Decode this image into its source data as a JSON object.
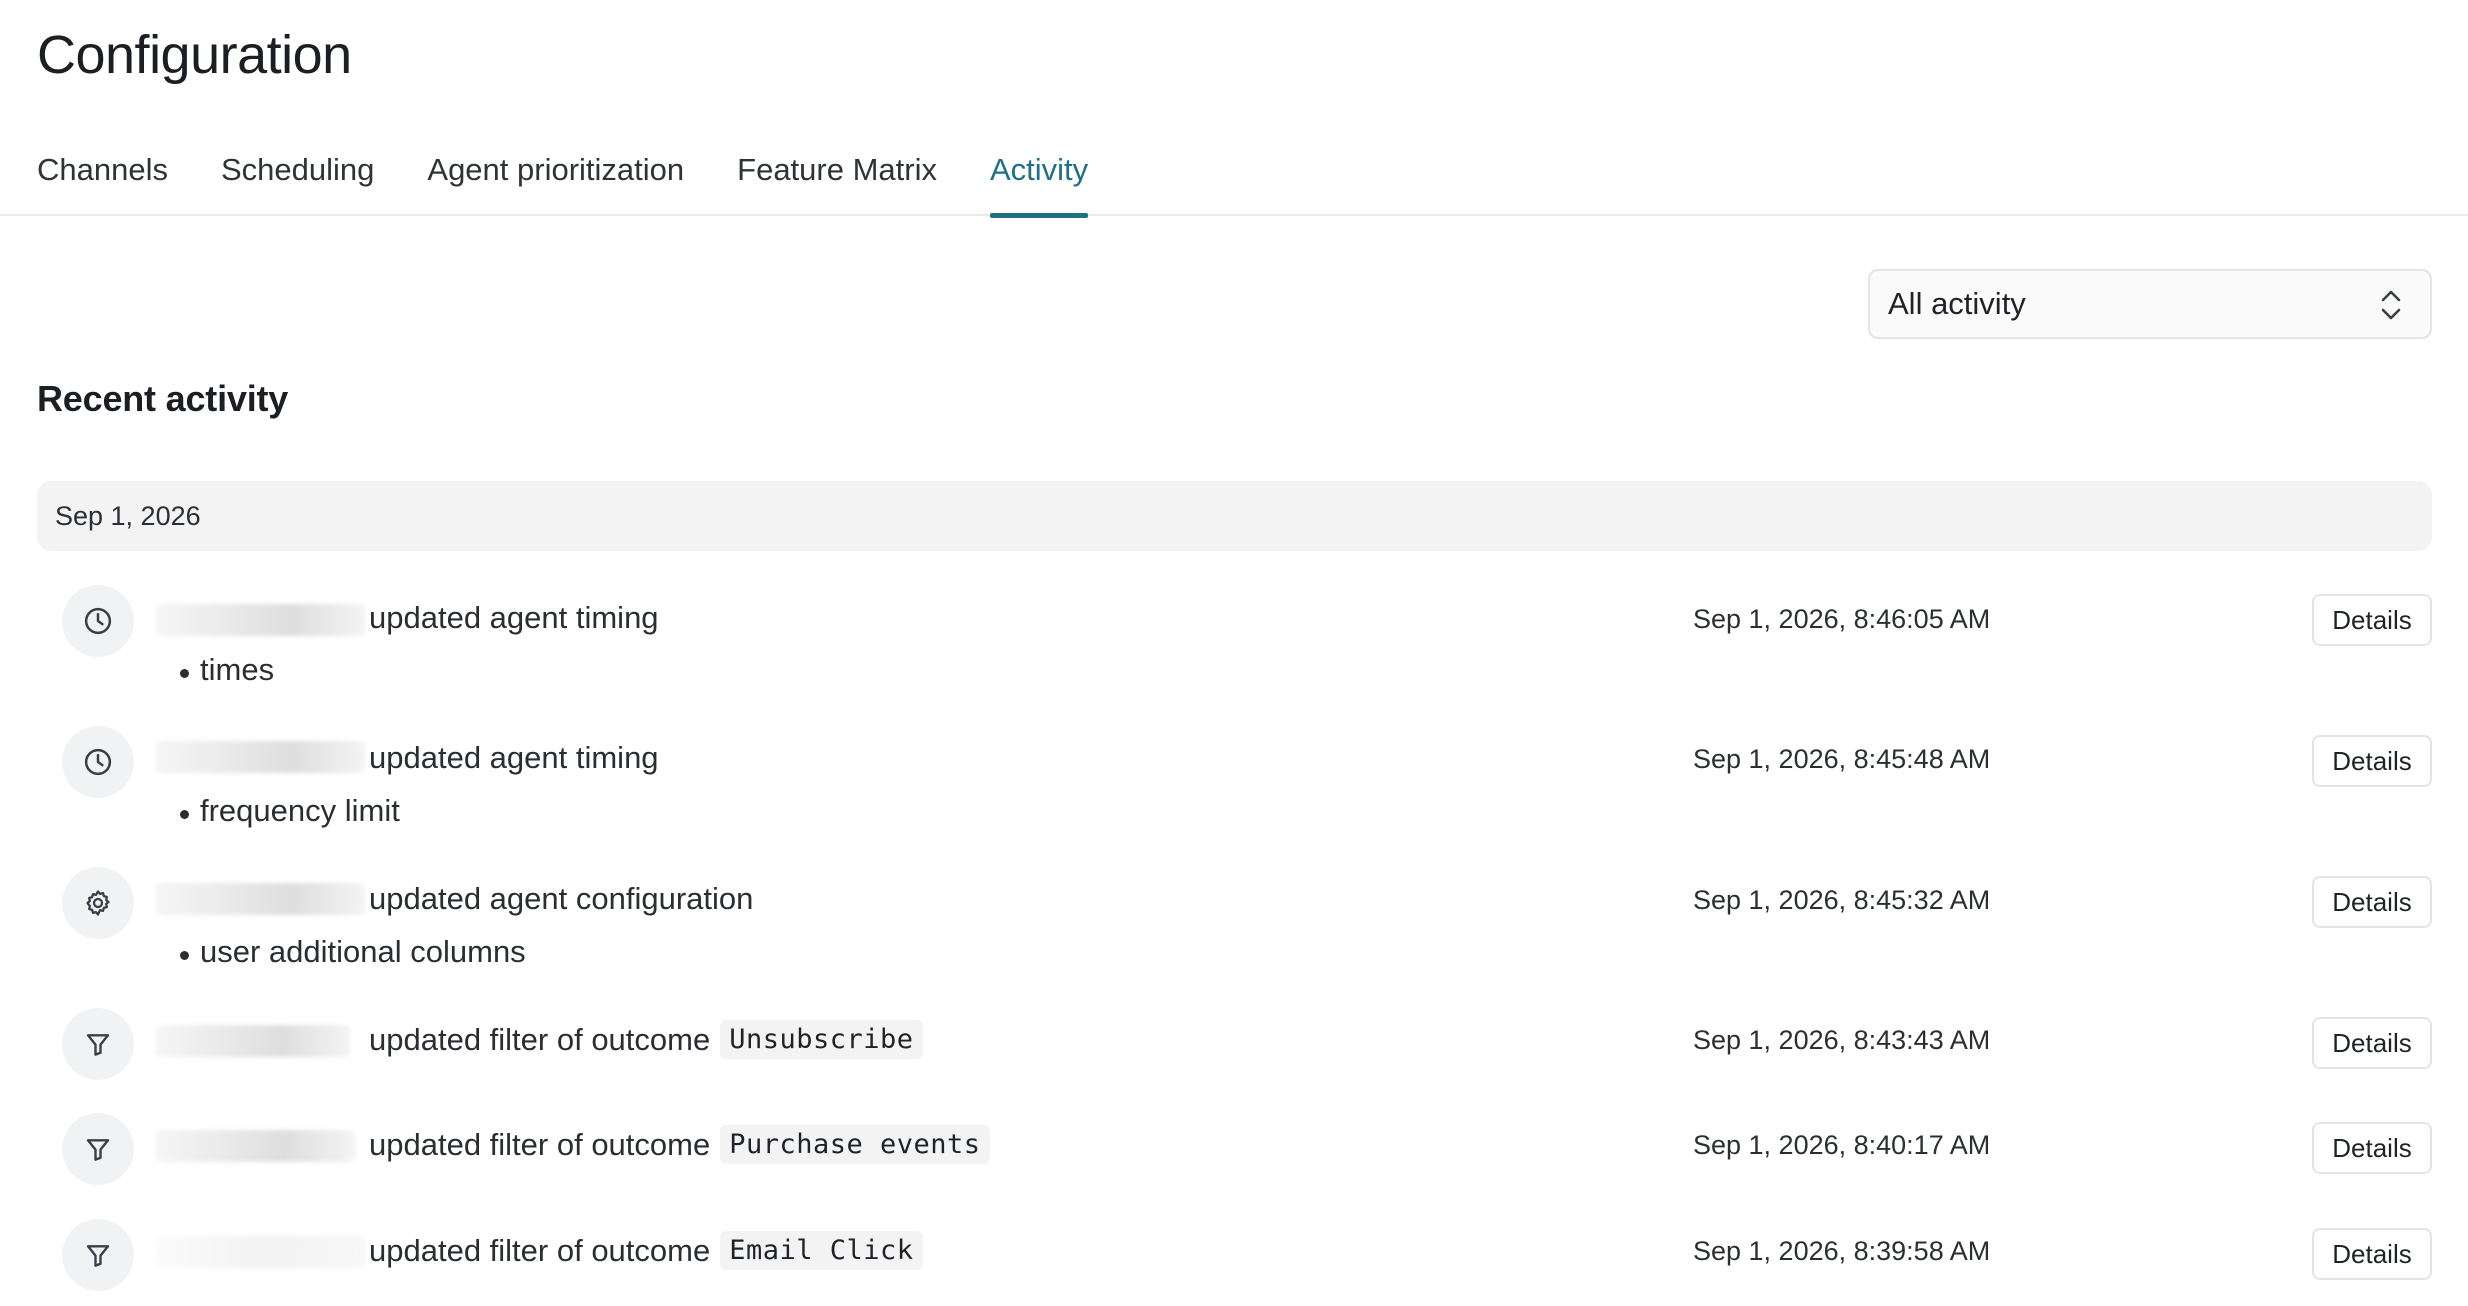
{
  "page": {
    "title": "Configuration"
  },
  "tabs": [
    {
      "label": "Channels",
      "active": false
    },
    {
      "label": "Scheduling",
      "active": false
    },
    {
      "label": "Agent prioritization",
      "active": false
    },
    {
      "label": "Feature Matrix",
      "active": false
    },
    {
      "label": "Activity",
      "active": true
    }
  ],
  "filter": {
    "selected": "All activity",
    "icon": "chevron-up-down-icon"
  },
  "section": {
    "title": "Recent activity"
  },
  "groups": [
    {
      "date": "Sep 1, 2026",
      "entries": [
        {
          "icon": "clock-icon",
          "action": "updated agent timing",
          "code": "",
          "bullet": "times",
          "timestamp": "Sep 1, 2026, 8:46:05 AM",
          "button": "Details"
        },
        {
          "icon": "clock-icon",
          "action": "updated agent timing",
          "code": "",
          "bullet": "frequency limit",
          "timestamp": "Sep 1, 2026, 8:45:48 AM",
          "button": "Details"
        },
        {
          "icon": "gear-icon",
          "action": "updated agent configuration",
          "code": "",
          "bullet": "user additional columns",
          "timestamp": "Sep 1, 2026, 8:45:32 AM",
          "button": "Details"
        },
        {
          "icon": "filter-icon",
          "action": "updated filter of outcome",
          "code": "Unsubscribe",
          "bullet": "",
          "timestamp": "Sep 1, 2026, 8:43:43 AM",
          "button": "Details"
        },
        {
          "icon": "filter-icon",
          "action": "updated filter of outcome",
          "code": "Purchase events",
          "bullet": "",
          "timestamp": "Sep 1, 2026, 8:40:17 AM",
          "button": "Details"
        },
        {
          "icon": "filter-icon",
          "action": "updated filter of outcome",
          "code": "Email Click",
          "bullet": "",
          "timestamp": "Sep 1, 2026, 8:39:58 AM",
          "button": "Details"
        }
      ]
    }
  ],
  "colors": {
    "accent": "#1f6f86",
    "text": "#1f2328",
    "date_band": "#f3f3f3",
    "icon_bg": "#f1f2f3",
    "border": "#e3e4e6"
  }
}
